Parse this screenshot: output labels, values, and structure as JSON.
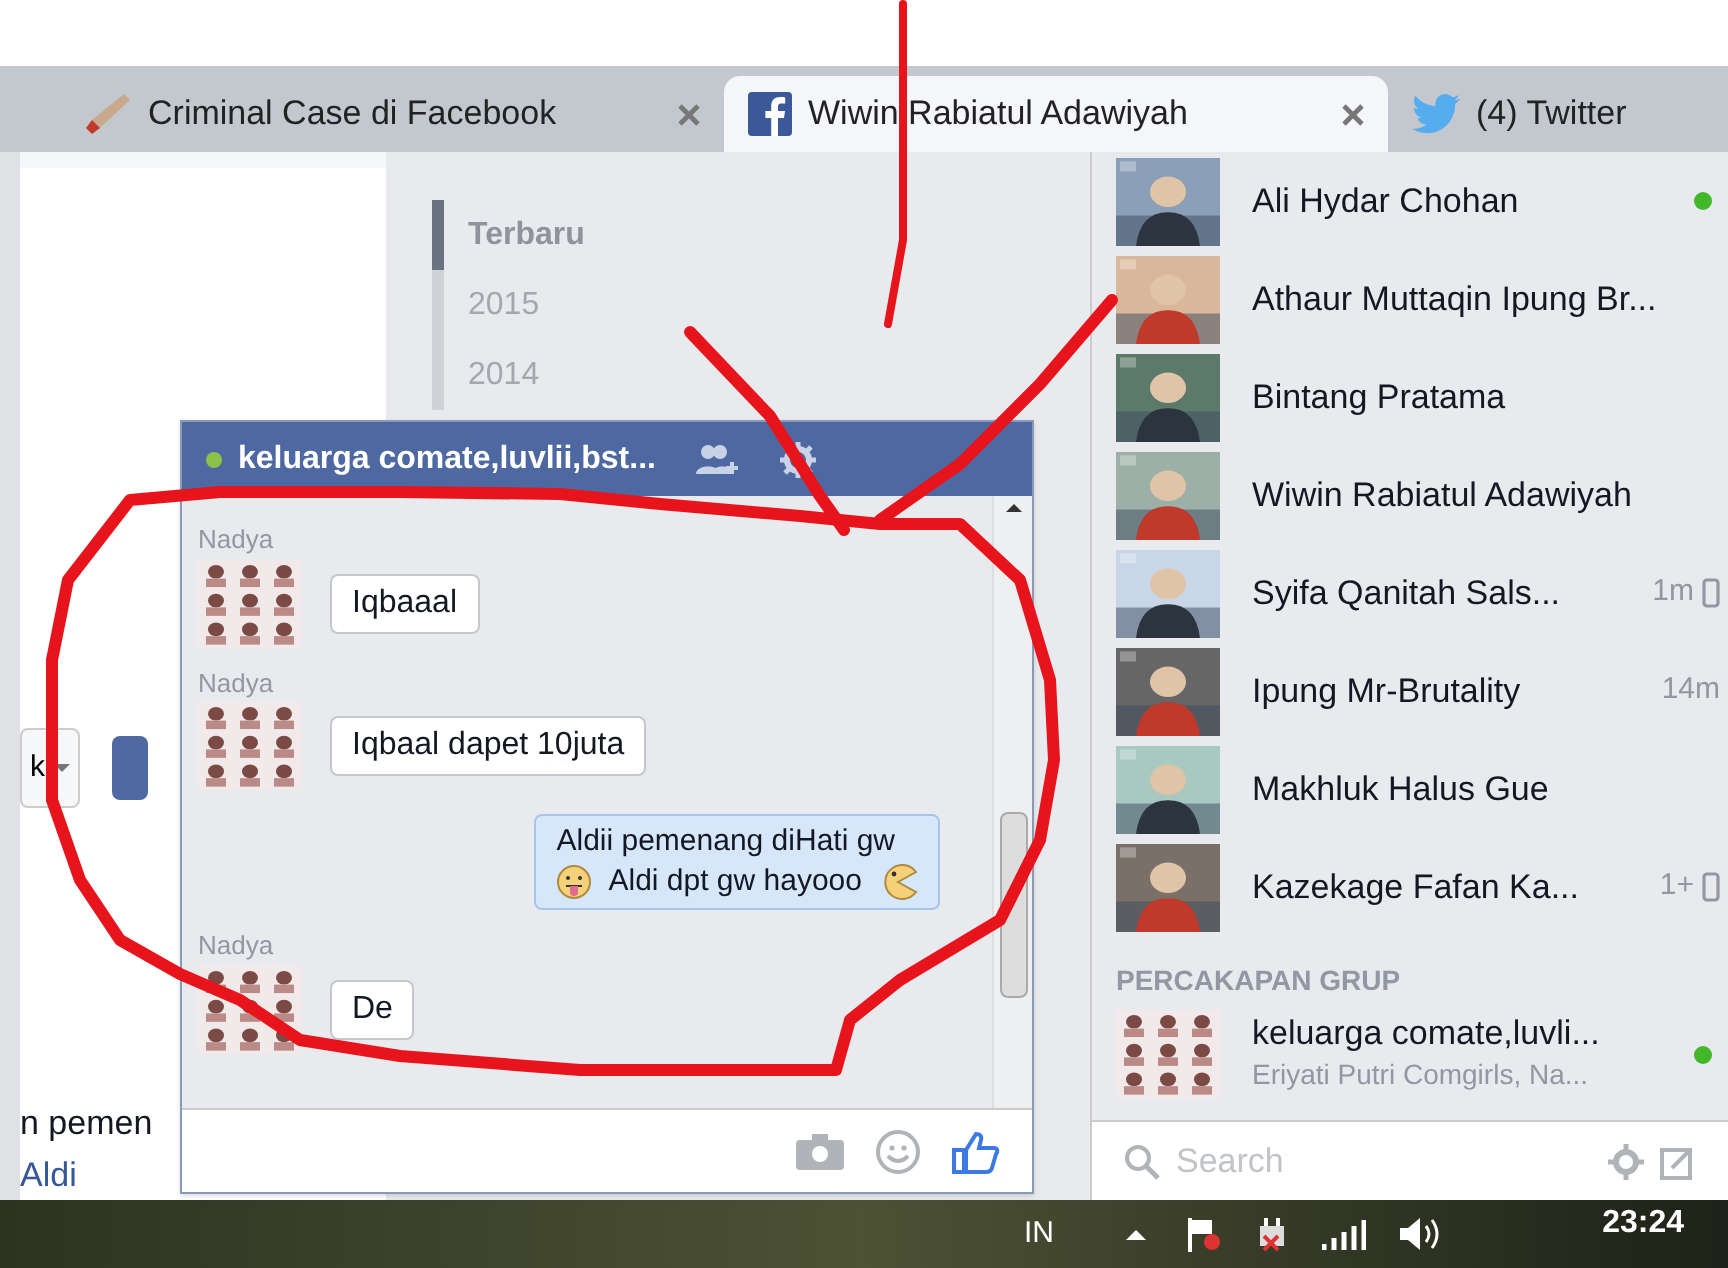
{
  "tabs": [
    {
      "title": "Criminal Case di Facebook",
      "kind": "game",
      "selected": false
    },
    {
      "title": "Wiwin Rabiatul Adawiyah",
      "kind": "facebook",
      "selected": true
    },
    {
      "title": "(4) Twitter",
      "kind": "twitter",
      "selected": false
    }
  ],
  "page": {
    "button_text": "k",
    "post_text": "n pemen",
    "link": "Aldi"
  },
  "timeline": [
    {
      "label": "Terbaru",
      "selected": true
    },
    {
      "label": "2015",
      "selected": false
    },
    {
      "label": "2014",
      "selected": false
    }
  ],
  "chat": {
    "title": "keluarga comate,luvlii,bst...",
    "online": true,
    "messages": [
      {
        "kind": "incoming",
        "sender": "Nadya",
        "lines": [
          "Iqbaaal"
        ]
      },
      {
        "kind": "incoming",
        "sender": "Nadya",
        "lines": [
          "Iqbaal dapet 10juta"
        ]
      },
      {
        "kind": "outgoing",
        "lines": [
          "Aldii pemenang diHati gw",
          "Aldi dpt gw hayooo"
        ]
      },
      {
        "kind": "incoming",
        "sender": "Nadya",
        "lines": [
          "De"
        ]
      }
    ]
  },
  "contacts": [
    {
      "name": "Ali Hydar Chohan",
      "online": true
    },
    {
      "name": "Athaur Muttaqin Ipung Br...",
      "online": false
    },
    {
      "name": "Bintang Pratama",
      "online": false
    },
    {
      "name": "Wiwin Rabiatul Adawiyah",
      "online": false
    },
    {
      "name": "Syifa Qanitah Sals...",
      "online": false,
      "time": "1m",
      "mobile": true
    },
    {
      "name": "Ipung Mr-Brutality",
      "online": false,
      "time": "14m"
    },
    {
      "name": "Makhluk Halus Gue",
      "online": false
    },
    {
      "name": "Kazekage Fafan Ka...",
      "online": false,
      "time": "1+",
      "mobile": true
    }
  ],
  "group_heading": "PERCAKAPAN GRUP",
  "groups": [
    {
      "name": "keluarga comate,luvli...",
      "members": "Eriyati Putri Comgirls, Na...",
      "online": true
    }
  ],
  "search": {
    "placeholder": "Search"
  },
  "taskbar": {
    "language": "IN",
    "time": "23:24"
  }
}
